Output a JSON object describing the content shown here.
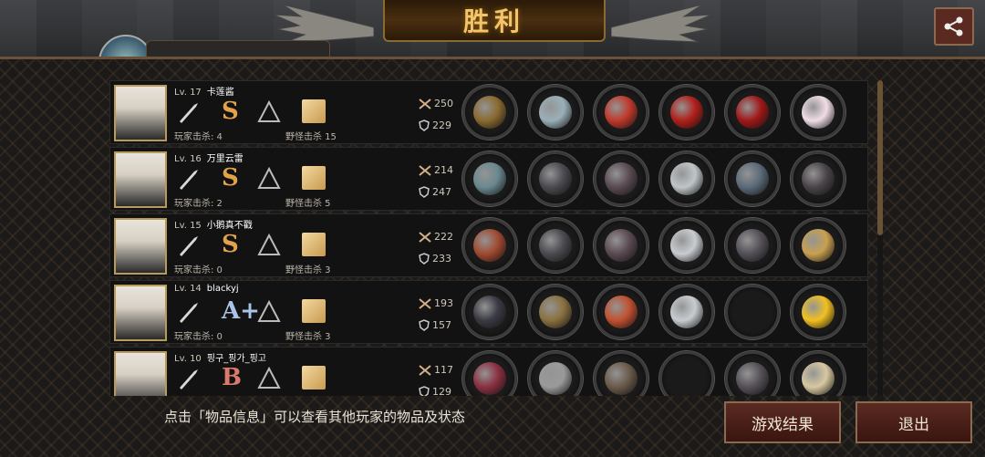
{
  "header": {
    "title": "胜利"
  },
  "players": [
    {
      "level": "Lv. 17",
      "name": "卡莲酱",
      "grade": "S",
      "player_kills": "玩家击杀: 4",
      "monster_kills": "野怪击杀 15",
      "attack": "250",
      "defense": "229",
      "items": [
        "staff",
        "helmet",
        "red-jacket",
        "red-bracelet",
        "red-heels",
        "pearl"
      ]
    },
    {
      "level": "Lv. 16",
      "name": "万里云雷",
      "grade": "S",
      "player_kills": "玩家击杀: 2",
      "monster_kills": "野怪击杀 5",
      "attack": "214",
      "defense": "247",
      "items": [
        "rifle",
        "dark-helmet",
        "dark-armor",
        "silver-disc",
        "boots",
        "dark-gauntlet"
      ]
    },
    {
      "level": "Lv. 15",
      "name": "小鹅真不戳",
      "grade": "S",
      "player_kills": "玩家击杀: 0",
      "monster_kills": "野怪击杀 3",
      "attack": "222",
      "defense": "233",
      "items": [
        "spear",
        "dark-helmet",
        "dark-armor",
        "silver-bracer",
        "gauntlet",
        "box"
      ]
    },
    {
      "level": "Lv. 14",
      "name": "blackyj",
      "grade": "A+",
      "player_kills": "玩家击杀: 0",
      "monster_kills": "野怪击杀 3",
      "attack": "193",
      "defense": "157",
      "items": [
        "blade",
        "gold-helmet",
        "red-cloth",
        "silver-bracer",
        "empty",
        "lily"
      ]
    },
    {
      "level": "Lv. 10",
      "name": "핑구_핑가_핑고",
      "grade": "B",
      "player_kills": "玩家击杀: 0",
      "monster_kills": "野怪击杀 3",
      "attack": "117",
      "defense": "129",
      "items": [
        "bow",
        "knight-helmet",
        "robe",
        "empty",
        "gauntlet",
        "book"
      ]
    }
  ],
  "footer": {
    "hint": "点击「物品信息」可以查看其他玩家的物品及状态",
    "result_button": "游戏结果",
    "exit_button": "退出"
  },
  "colors": {
    "accent": "#f3c56a",
    "button": "#5a2a22",
    "frame": "#b89a5a"
  }
}
